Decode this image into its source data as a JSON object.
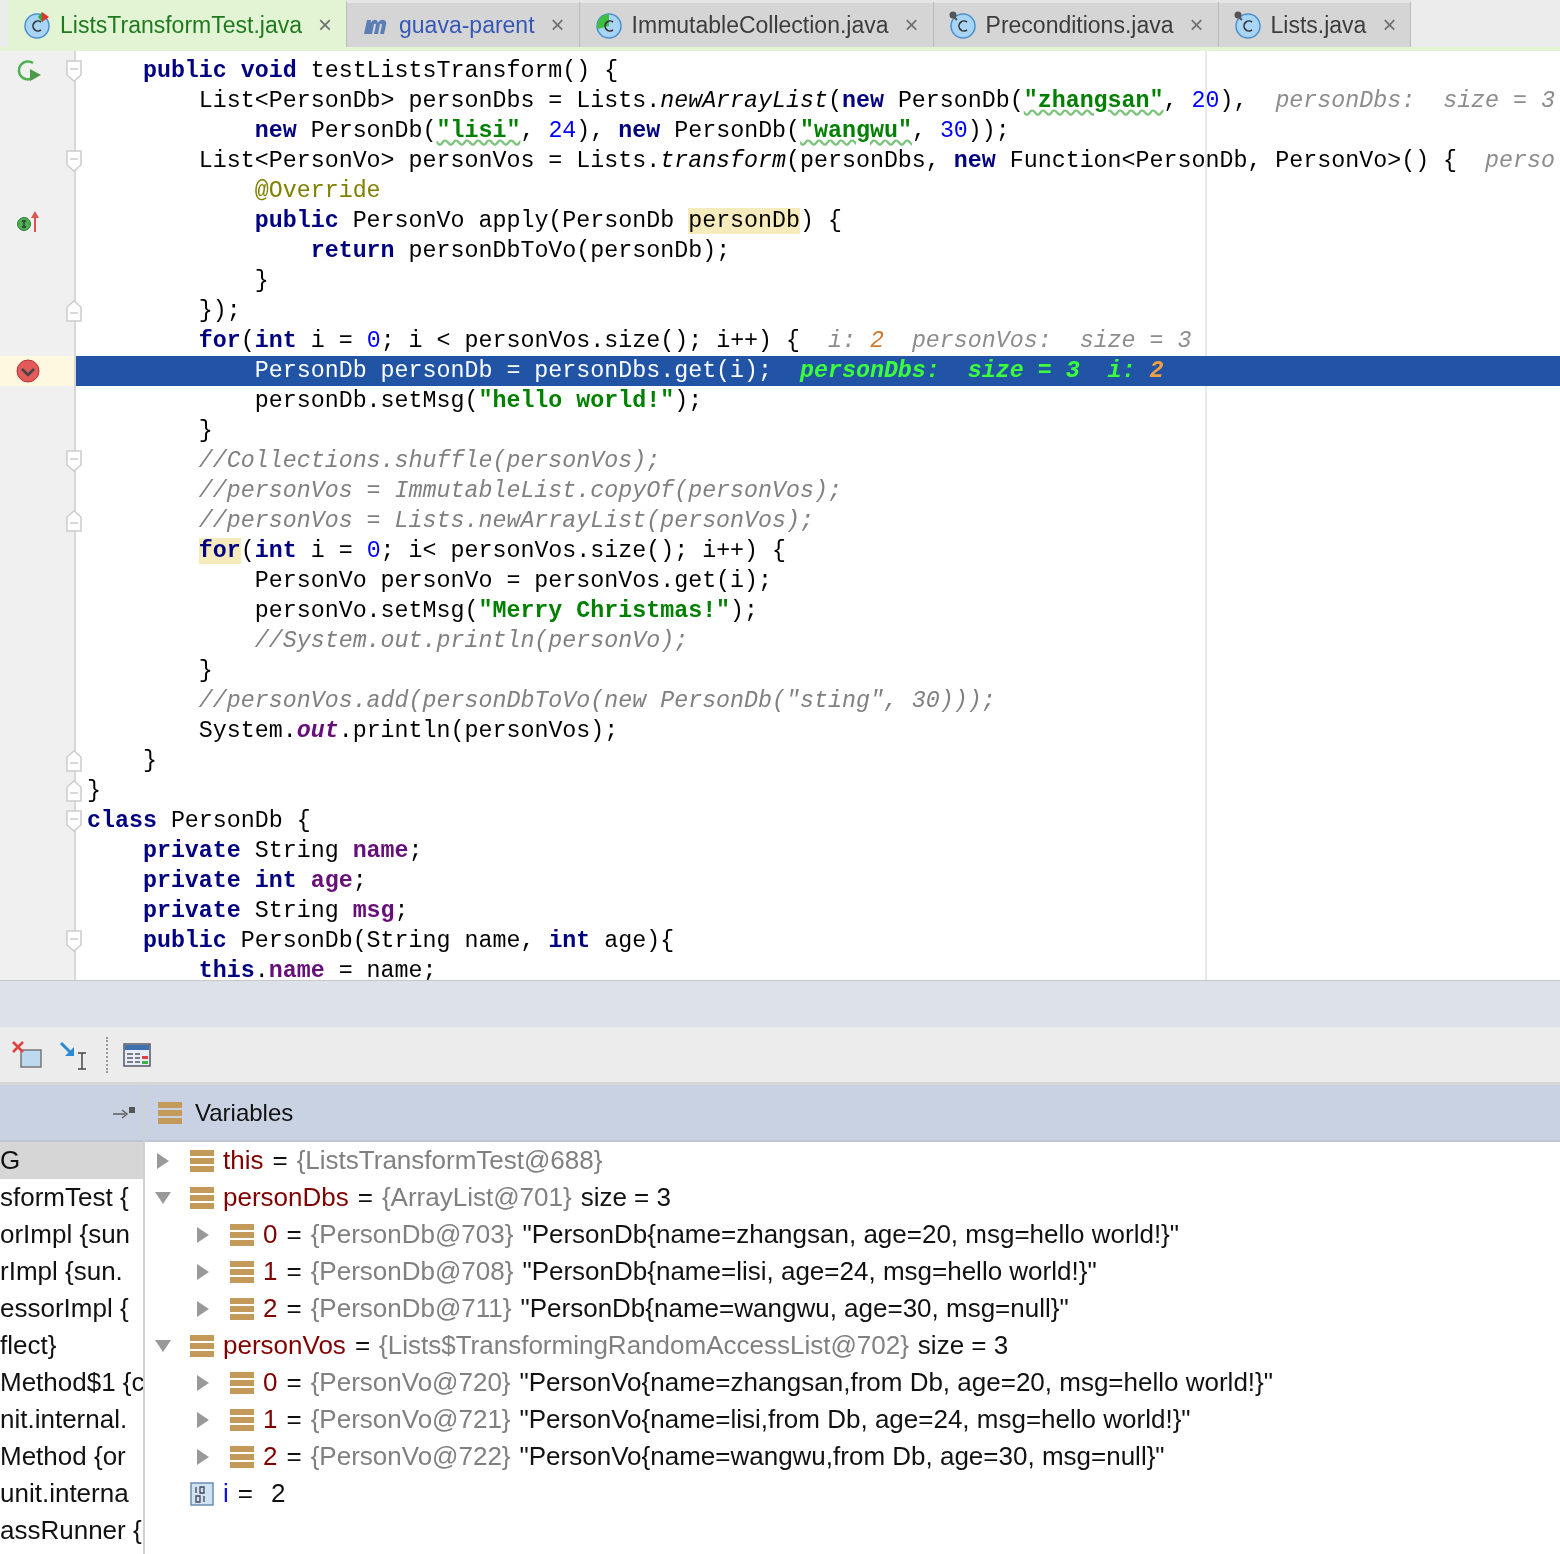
{
  "tabs": [
    {
      "label": "ListsTransformTest.java",
      "kind": "test-class",
      "color": "#1f7a1f",
      "selected": true
    },
    {
      "label": "guava-parent",
      "kind": "maven",
      "color": "#3557b7",
      "selected": false
    },
    {
      "label": "ImmutableCollection.java",
      "kind": "coverage-class",
      "color": "#3c3c3c",
      "selected": false
    },
    {
      "label": "Preconditions.java",
      "kind": "pinned-class",
      "color": "#3c3c3c",
      "selected": false
    },
    {
      "label": "Lists.java",
      "kind": "pinned-class",
      "color": "#3c3c3c",
      "selected": false
    }
  ],
  "close_glyph": "×",
  "editor": {
    "lines": [
      {
        "current": false,
        "markers": [
          {
            "kind": "run"
          },
          {
            "kind": "fold-start"
          }
        ],
        "segments": [
          {
            "kind": "keyword",
            "text": "    public void"
          },
          " testListsTransform() {"
        ]
      },
      {
        "current": false,
        "segments": [
          "        List<PersonDb> personDbs = Lists.",
          {
            "kind": "static-call",
            "text": "newArrayList"
          },
          "(",
          {
            "kind": "keyword",
            "text": "new"
          },
          " PersonDb(",
          {
            "kind": "typo-string",
            "text": "\"zhangsan\""
          },
          ", ",
          {
            "kind": "number",
            "text": "20"
          },
          "),",
          {
            "kind": "hint",
            "text": "personDbs:  size = 3"
          }
        ]
      },
      {
        "current": false,
        "segments": [
          {
            "kind": "keyword",
            "text": "            new"
          },
          " PersonDb(",
          {
            "kind": "typo-string",
            "text": "\"lisi\""
          },
          ", ",
          {
            "kind": "number",
            "text": "24"
          },
          "), ",
          {
            "kind": "keyword",
            "text": "new"
          },
          " PersonDb(",
          {
            "kind": "typo-string",
            "text": "\"wangwu\""
          },
          ", ",
          {
            "kind": "number",
            "text": "30"
          },
          "));"
        ]
      },
      {
        "current": false,
        "markers": [
          {
            "kind": "fold-start"
          }
        ],
        "segments": [
          "        List<PersonVo> personVos = Lists.",
          {
            "kind": "static-call",
            "text": "transform"
          },
          "(personDbs, ",
          {
            "kind": "keyword",
            "text": "new"
          },
          " Function<PersonDb, PersonVo>() {",
          {
            "kind": "hint",
            "text": "perso"
          }
        ]
      },
      {
        "current": false,
        "segments": [
          {
            "kind": "annotation",
            "text": "            @Override"
          }
        ]
      },
      {
        "current": false,
        "markers": [
          {
            "kind": "implements"
          }
        ],
        "segments": [
          {
            "kind": "keyword",
            "text": "            public"
          },
          " PersonVo apply(PersonDb ",
          {
            "kind": "match",
            "text": "personDb"
          },
          ") {"
        ]
      },
      {
        "current": false,
        "segments": [
          {
            "kind": "keyword",
            "text": "                return"
          },
          " personDbToVo(personDb);"
        ]
      },
      {
        "current": false,
        "segments": [
          "            }"
        ]
      },
      {
        "current": false,
        "markers": [
          {
            "kind": "fold-end"
          }
        ],
        "segments": [
          "        });"
        ]
      },
      {
        "current": false,
        "segments": [
          {
            "kind": "keyword",
            "text": "        for"
          },
          "(",
          {
            "kind": "keyword",
            "text": "int"
          },
          " i = ",
          {
            "kind": "number",
            "text": "0"
          },
          "; i < personVos.size(); i++) {",
          {
            "kind": "hint",
            "text": "i: "
          },
          {
            "kind": "hint-value",
            "text": "2"
          },
          {
            "kind": "hint-more",
            "text": "personVos:  size = 3"
          }
        ]
      },
      {
        "current": true,
        "markers": [
          {
            "kind": "breakpoint"
          }
        ],
        "segments": [
          "            PersonDb personDb = personDbs.get(i);",
          {
            "kind": "hint",
            "text": "personDbs:  size = 3"
          },
          {
            "kind": "hint-more",
            "text": "i: "
          },
          {
            "kind": "hint-value",
            "text": "2"
          }
        ]
      },
      {
        "current": false,
        "segments": [
          "            personDb.setMsg(",
          {
            "kind": "string",
            "text": "\"hello world!\""
          },
          ");"
        ]
      },
      {
        "current": false,
        "segments": [
          "        }"
        ]
      },
      {
        "current": false,
        "markers": [
          {
            "kind": "fold-start"
          }
        ],
        "segments": [
          {
            "kind": "comment",
            "text": "        //Collections.shuffle(personVos);"
          }
        ]
      },
      {
        "current": false,
        "segments": [
          {
            "kind": "comment",
            "text": "        //personVos = ImmutableList.copyOf(personVos);"
          }
        ]
      },
      {
        "current": false,
        "markers": [
          {
            "kind": "fold-end"
          }
        ],
        "segments": [
          {
            "kind": "comment",
            "text": "        //personVos = Lists.newArrayList(personVos);"
          }
        ]
      },
      {
        "current": false,
        "segments": [
          {
            "kind": "indented-match-keyword",
            "text": "for"
          },
          "(",
          {
            "kind": "keyword",
            "text": "int"
          },
          " i = ",
          {
            "kind": "number",
            "text": "0"
          },
          "; i< personVos.size(); i++) {"
        ]
      },
      {
        "current": false,
        "segments": [
          "            PersonVo personVo = personVos.get(i);"
        ]
      },
      {
        "current": false,
        "segments": [
          "            personVo.setMsg(",
          {
            "kind": "string",
            "text": "\"Merry Christmas!\""
          },
          ");"
        ]
      },
      {
        "current": false,
        "segments": [
          {
            "kind": "comment",
            "text": "            //System.out.println(personVo);"
          }
        ]
      },
      {
        "current": false,
        "segments": [
          "        }"
        ]
      },
      {
        "current": false,
        "segments": [
          {
            "kind": "comment",
            "text": "        //personVos.add(personDbToVo(new PersonDb(\"sting\", 30)));"
          }
        ]
      },
      {
        "current": false,
        "segments": [
          "        System.",
          {
            "kind": "static-field",
            "text": "out"
          },
          ".println(personVos);"
        ]
      },
      {
        "current": false,
        "markers": [
          {
            "kind": "fold-end"
          }
        ],
        "segments": [
          "    }"
        ]
      },
      {
        "current": false,
        "markers": [
          {
            "kind": "fold-end"
          }
        ],
        "segments": [
          "}"
        ]
      },
      {
        "current": false,
        "markers": [
          {
            "kind": "fold-start"
          }
        ],
        "segments": [
          {
            "kind": "keyword",
            "text": "class"
          },
          " PersonDb {"
        ]
      },
      {
        "current": false,
        "segments": [
          {
            "kind": "keyword",
            "text": "    private"
          },
          " String ",
          {
            "kind": "field",
            "text": "name"
          },
          ";"
        ]
      },
      {
        "current": false,
        "segments": [
          {
            "kind": "keyword",
            "text": "    private int "
          },
          {
            "kind": "field",
            "text": "age"
          },
          ";"
        ]
      },
      {
        "current": false,
        "segments": [
          {
            "kind": "keyword",
            "text": "    private"
          },
          " String ",
          {
            "kind": "field",
            "text": "msg"
          },
          ";"
        ]
      },
      {
        "current": false,
        "markers": [
          {
            "kind": "fold-start"
          }
        ],
        "segments": [
          {
            "kind": "keyword",
            "text": "    public"
          },
          " PersonDb(String name, ",
          {
            "kind": "keyword",
            "text": "int"
          },
          " age){"
        ]
      },
      {
        "current": false,
        "segments": [
          {
            "kind": "keyword",
            "text": "        this"
          },
          ".",
          {
            "kind": "field",
            "text": "name"
          },
          " = name;"
        ]
      }
    ]
  },
  "frames": {
    "items": [
      {
        "label": "G",
        "selected": true
      },
      {
        "label": "sformTest {",
        "selected": false
      },
      {
        "label": "orImpl {sun",
        "selected": false
      },
      {
        "label": "rImpl {sun.",
        "selected": false
      },
      {
        "label": "essorImpl {",
        "selected": false
      },
      {
        "label": "flect}",
        "selected": false
      },
      {
        "label": "Method$1 {c",
        "selected": false
      },
      {
        "label": "nit.internal.",
        "selected": false
      },
      {
        "label": "Method {or",
        "selected": false
      },
      {
        "label": "unit.interna",
        "selected": false
      },
      {
        "label": "assRunner {",
        "selected": false
      }
    ]
  },
  "variables": {
    "title": "Variables",
    "items": [
      {
        "kind": "object",
        "name": "this",
        "operator": "=",
        "ref": "{ListsTransformTest@688}",
        "expanded": false
      },
      {
        "kind": "object",
        "name": "personDbs",
        "operator": "=",
        "ref": "{ArrayList@701}",
        "value": "size = 3",
        "expanded": true,
        "children": [
          {
            "kind": "object",
            "name": "0",
            "operator": "=",
            "ref": "{PersonDb@703}",
            "value": "\"PersonDb{name=zhangsan, age=20, msg=hello world!}\"",
            "expanded": false
          },
          {
            "kind": "object",
            "name": "1",
            "operator": "=",
            "ref": "{PersonDb@708}",
            "value": "\"PersonDb{name=lisi, age=24, msg=hello world!}\"",
            "expanded": false
          },
          {
            "kind": "object",
            "name": "2",
            "operator": "=",
            "ref": "{PersonDb@711}",
            "value": "\"PersonDb{name=wangwu, age=30, msg=null}\"",
            "expanded": false
          }
        ]
      },
      {
        "kind": "object",
        "name": "personVos",
        "operator": "=",
        "ref": "{Lists$TransformingRandomAccessList@702}",
        "value": "size = 3",
        "expanded": true,
        "children": [
          {
            "kind": "object",
            "name": "0",
            "operator": "=",
            "ref": "{PersonVo@720}",
            "value": "\"PersonVo{name=zhangsan,from Db, age=20, msg=hello world!}\"",
            "expanded": false
          },
          {
            "kind": "object",
            "name": "1",
            "operator": "=",
            "ref": "{PersonVo@721}",
            "value": "\"PersonVo{name=lisi,from Db, age=24, msg=hello world!}\"",
            "expanded": false
          },
          {
            "kind": "object",
            "name": "2",
            "operator": "=",
            "ref": "{PersonVo@722}",
            "value": "\"PersonVo{name=wangwu,from Db, age=30, msg=null}\"",
            "expanded": false
          }
        ]
      },
      {
        "kind": "primitive",
        "name": "i",
        "operator": "=",
        "value": "2"
      }
    ]
  }
}
